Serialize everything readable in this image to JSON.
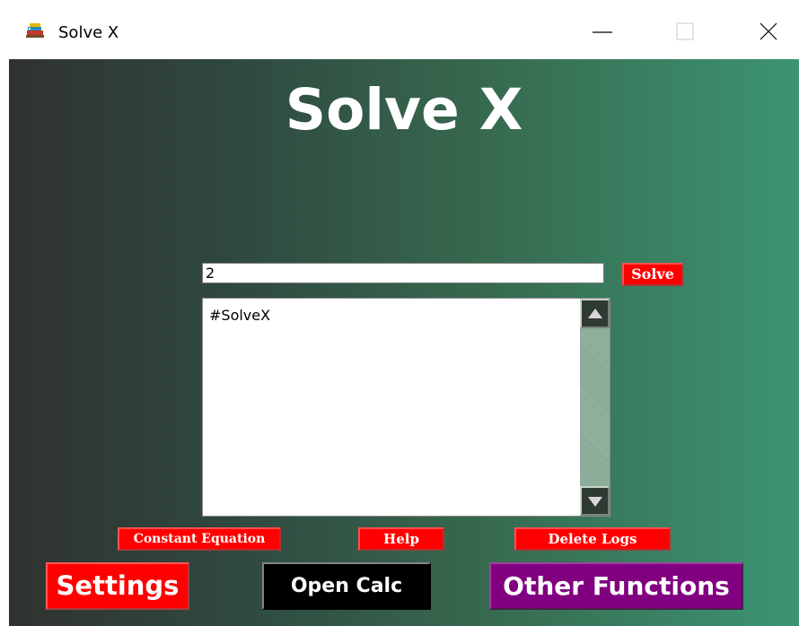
{
  "window": {
    "title": "Solve X",
    "icon": "books-icon",
    "controls": [
      "minimize-icon",
      "maximize-icon",
      "close-icon"
    ]
  },
  "app": {
    "heading": "Solve X"
  },
  "equation_input": {
    "value": "2",
    "placeholder": ""
  },
  "solve_button": {
    "label": "Solve"
  },
  "log": {
    "text": "#SolveX"
  },
  "actions": {
    "constant_equation": "Constant Equation",
    "help": "Help",
    "delete_logs": "Delete Logs"
  },
  "main_buttons": {
    "settings": "Settings",
    "open_calc": "Open Calc",
    "other_functions": "Other Functions"
  },
  "colors": {
    "gradient_left": "#303230",
    "gradient_right": "#3c9472",
    "red_button": "#ff0000",
    "purple_button": "#800080",
    "black_button": "#000000",
    "text_white": "#ffffff"
  }
}
